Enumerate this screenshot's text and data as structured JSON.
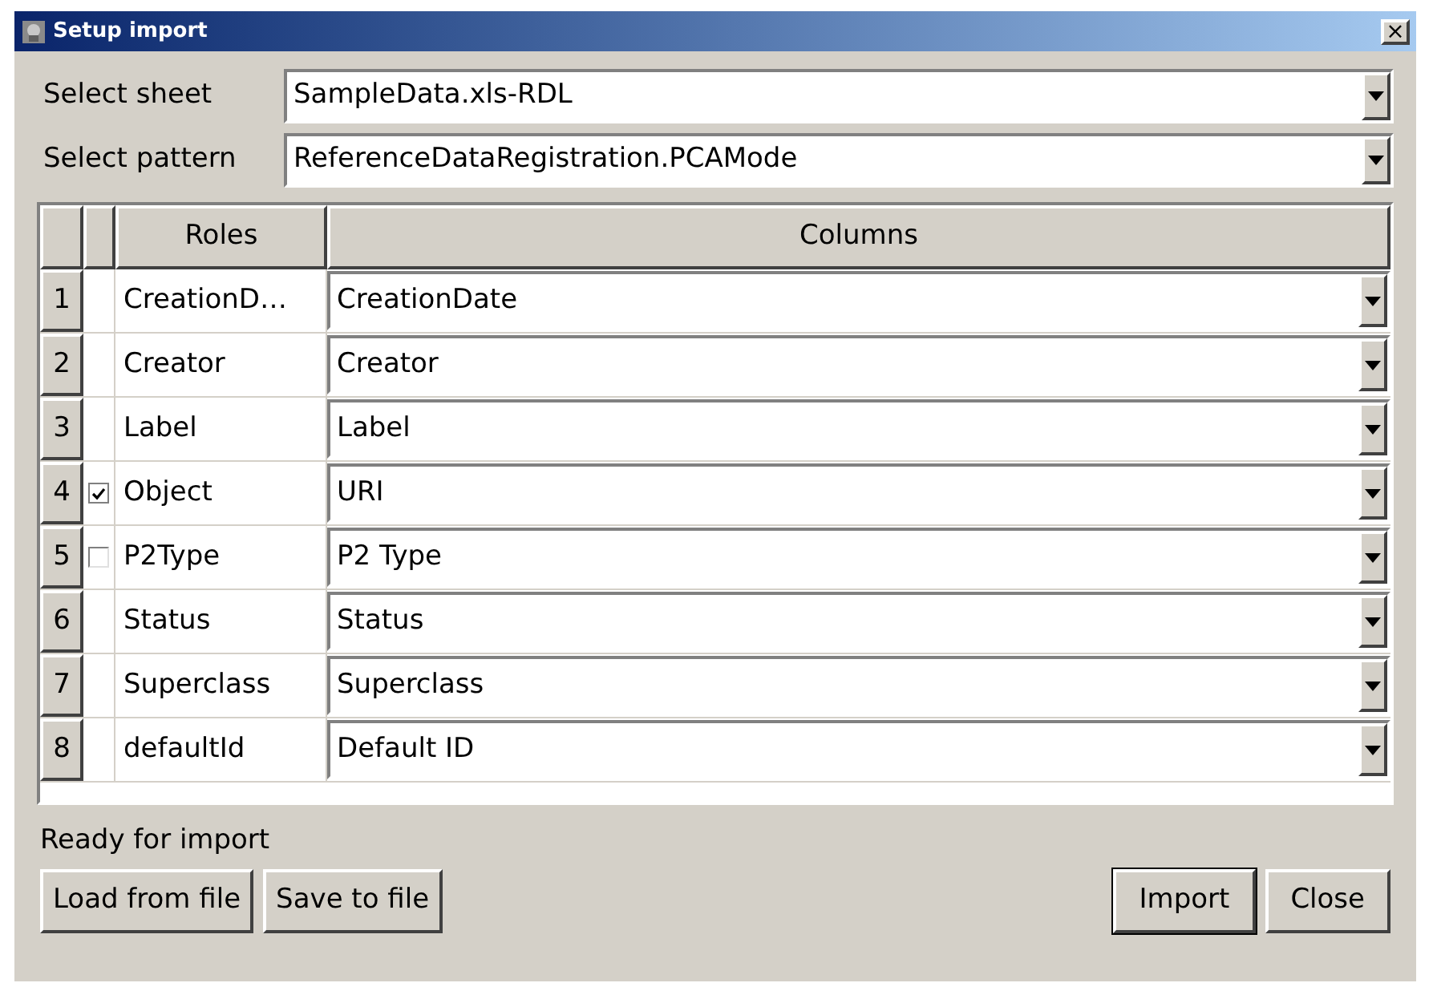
{
  "window": {
    "title": "Setup import",
    "close": "×"
  },
  "fields": [
    {
      "label": "Select sheet",
      "value": "SampleData.xls-RDL"
    },
    {
      "label": "Select pattern",
      "value": "ReferenceDataRegistration.PCAMode"
    }
  ],
  "table": {
    "columns": [
      "Roles",
      "Columns"
    ],
    "rows": [
      {
        "number": "1",
        "kind": "plain",
        "role": "CreationD…",
        "column": "CreationDate"
      },
      {
        "number": "2",
        "kind": "plain",
        "role": "Creator",
        "column": "Creator"
      },
      {
        "number": "3",
        "kind": "plain",
        "role": "Label",
        "column": "Label"
      },
      {
        "number": "4",
        "kind": "checkbox",
        "checked": true,
        "role": "Object",
        "column": "URI"
      },
      {
        "number": "5",
        "kind": "checkbox",
        "checked": false,
        "role": "P2Type",
        "column": "P2 Type"
      },
      {
        "number": "6",
        "kind": "plain",
        "role": "Status",
        "column": "Status"
      },
      {
        "number": "7",
        "kind": "plain",
        "role": "Superclass",
        "column": "Superclass"
      },
      {
        "number": "8",
        "kind": "plain",
        "role": "defaultId",
        "column": "Default ID"
      }
    ]
  },
  "status": "Ready for import",
  "buttons_left": [
    "Load from file",
    "Save to file"
  ],
  "buttons_right": [
    "Import",
    "Close"
  ]
}
